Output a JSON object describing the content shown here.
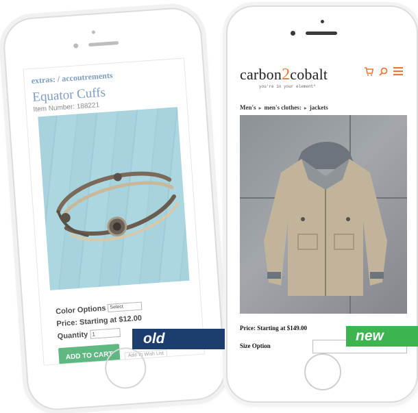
{
  "old_site": {
    "breadcrumb": "extras: / accoutrements",
    "product_title": "Equator Cuffs",
    "item_number": "Item Number: 188221",
    "color_label": "Color Options",
    "color_select_value": "Select",
    "price": "Price: Starting at $12.00",
    "quantity_label": "Quantity",
    "quantity_value": "1",
    "add_to_cart": "ADD TO CART",
    "wish_list": "Add To Wish List"
  },
  "new_site": {
    "logo_part1": "carbon",
    "logo_accent": "2",
    "logo_part2": "cobalt",
    "tagline": "you're in your element*",
    "breadcrumb": [
      "Men's",
      "men's clothes:",
      "jackets"
    ],
    "breadcrumb_separator": "▸",
    "price": "Price: Starting at $149.00",
    "size_option_label": "Size Option",
    "icons": [
      "cart-icon",
      "search-icon",
      "menu-icon"
    ],
    "accent_color": "#e8793a"
  },
  "labels": {
    "old": "old",
    "new": "new",
    "old_color": "#1c3d6e",
    "new_color": "#3cb44f"
  }
}
